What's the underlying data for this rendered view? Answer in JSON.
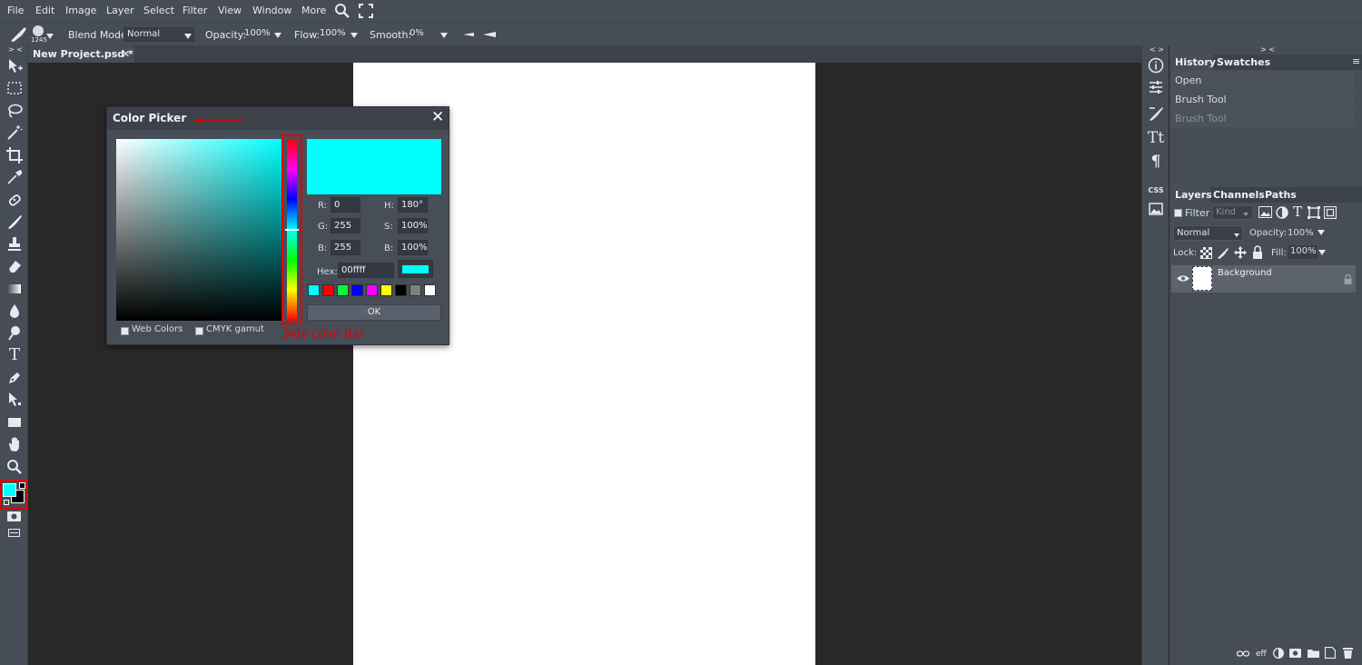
{
  "menu": [
    "File",
    "Edit",
    "Image",
    "Layer",
    "Select",
    "Filter",
    "View",
    "Window",
    "More"
  ],
  "icons": {
    "search": "search-icon",
    "fullscreen": "fullscreen-icon"
  },
  "options": {
    "brush_size": "1245",
    "blend_label": "Blend Mode:",
    "blend_value": "Normal",
    "opacity_label": "Opacity:",
    "opacity_value": "100%",
    "flow_label": "Flow:",
    "flow_value": "100%",
    "smooth_label": "Smooth:",
    "smooth_value": "0%"
  },
  "document": {
    "tab_label": "New Project.psd *",
    "close": "✕"
  },
  "panel_collapse": {
    "left": "> <",
    "middle": "< >",
    "right": "> <"
  },
  "history": {
    "tabs": [
      "History",
      "Swatches"
    ],
    "items": [
      "Open",
      "Brush Tool",
      "Brush Tool"
    ],
    "menu": "≡"
  },
  "layers": {
    "tabs": [
      "Layers",
      "Channels",
      "Paths"
    ],
    "filter_label": "Filter",
    "kind_value": "Kind",
    "blend_value": "Normal",
    "opacity_label": "Opacity:",
    "opacity_value": "100%",
    "lock_label": "Lock:",
    "fill_label": "Fill:",
    "fill_value": "100%",
    "layer_name": "Background",
    "bottom_eff": "eff"
  },
  "color_picker": {
    "title": "Color Picker",
    "close": "✕",
    "r_label": "R:",
    "r_value": "0",
    "g_label": "G:",
    "g_value": "255",
    "b_label": "B:",
    "b_value": "255",
    "h_label": "H:",
    "h_value": "180°",
    "s_label": "S:",
    "s_value": "100%",
    "bright_label": "B:",
    "bright_value": "100%",
    "hex_label": "Hex:",
    "hex_value": "00ffff",
    "ok_label": "OK",
    "web_colors_label": "Web Colors",
    "cmyk_label": "CMYK gamut",
    "current_color": "#00ffff",
    "swatches": [
      "#00ffff",
      "#ff0000",
      "#00ff40",
      "#0000ff",
      "#ff00ff",
      "#ffff00",
      "#000000",
      "#808080",
      "#ffffff"
    ]
  },
  "annotation": {
    "side_bar_label": "Side color bar",
    "color": "#e00000"
  },
  "toolbar": {
    "foreground": "#00ffff",
    "background": "#000000",
    "tools": [
      "move-tool-icon",
      "marquee-tool-icon",
      "lasso-tool-icon",
      "magic-wand-icon",
      "crop-tool-icon",
      "eyedropper-icon",
      "healing-brush-icon",
      "brush-tool-icon",
      "stamp-tool-icon",
      "eraser-icon",
      "gradient-icon",
      "blur-icon",
      "dodge-icon",
      "type-tool-icon",
      "pen-tool-icon",
      "path-select-icon",
      "rectangle-tool-icon",
      "hand-tool-icon",
      "zoom-tool-icon"
    ]
  }
}
